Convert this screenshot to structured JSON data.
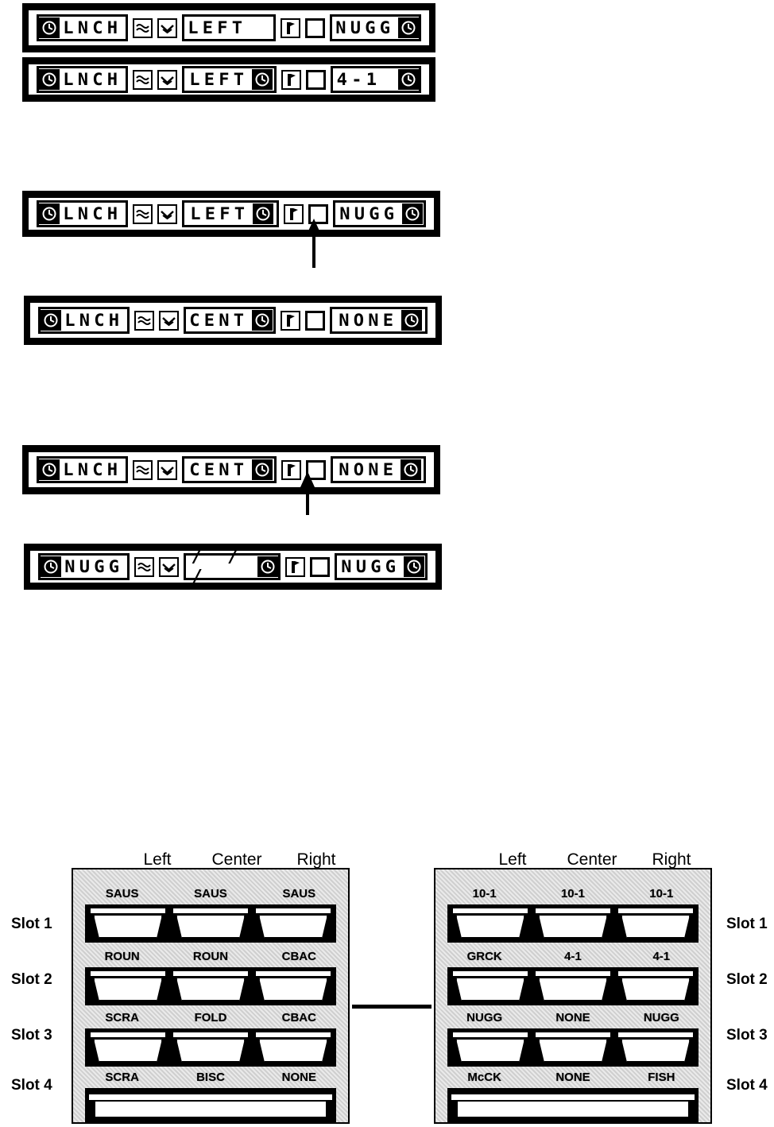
{
  "display_bars": [
    {
      "id": "bar-1",
      "left_field": {
        "icon": "clock-icon",
        "text": "LNCH"
      },
      "icons": [
        "wave-icon",
        "wave-down-icon"
      ],
      "position_field": {
        "text": "LEFT",
        "icon": null
      },
      "flag_icon": "f-flag-icon",
      "checkbox": "empty-box",
      "product_field": {
        "text": "NUGG",
        "icon": "clock-icon"
      },
      "pointer": null
    },
    {
      "id": "bar-2",
      "left_field": {
        "icon": "clock-icon",
        "text": "LNCH"
      },
      "icons": [
        "wave-icon",
        "wave-down-icon"
      ],
      "position_field": {
        "text": "LEFT",
        "icon": "clock-icon"
      },
      "flag_icon": "f-flag-icon",
      "checkbox": "empty-box",
      "product_field": {
        "text": "4-1",
        "icon": "clock-icon"
      },
      "pointer": null
    },
    {
      "id": "bar-3",
      "left_field": {
        "icon": "clock-icon",
        "text": "LNCH"
      },
      "icons": [
        "wave-icon",
        "wave-down-icon"
      ],
      "position_field": {
        "text": "LEFT",
        "icon": "clock-icon"
      },
      "flag_icon": "f-flag-icon",
      "checkbox": "empty-box",
      "product_field": {
        "text": "NUGG",
        "icon": "clock-icon"
      },
      "pointer": "up-arrow-pointer"
    },
    {
      "id": "bar-4",
      "left_field": {
        "icon": "clock-icon",
        "text": "LNCH"
      },
      "icons": [
        "wave-icon",
        "wave-down-icon"
      ],
      "position_field": {
        "text": "CENT",
        "icon": "clock-icon"
      },
      "flag_icon": "f-flag-icon",
      "checkbox": "empty-box",
      "product_field": {
        "text": "NONE",
        "icon": "clock-icon"
      },
      "pointer": null
    },
    {
      "id": "bar-5",
      "left_field": {
        "icon": "clock-icon",
        "text": "LNCH"
      },
      "icons": [
        "wave-icon",
        "wave-down-icon"
      ],
      "position_field": {
        "text": "CENT",
        "icon": "clock-icon"
      },
      "flag_icon": "f-flag-icon",
      "checkbox": "empty-box",
      "product_field": {
        "text": "NONE",
        "icon": "clock-icon"
      },
      "pointer": "up-arrow-pointer"
    },
    {
      "id": "bar-6",
      "left_field": {
        "icon": "clock-icon",
        "text": "NUGG"
      },
      "icons": [
        "wave-icon",
        "wave-down-icon"
      ],
      "position_field": {
        "text": "/ / /",
        "icon": "clock-icon"
      },
      "flag_icon": "f-flag-icon",
      "checkbox": "empty-box",
      "product_field": {
        "text": "NUGG",
        "icon": "clock-icon"
      },
      "pointer": null
    }
  ],
  "bar_text": {
    "b1_left": "LNCH",
    "b1_pos": "LEFT",
    "b1_prod": "NUGG",
    "b2_left": "LNCH",
    "b2_pos": "LEFT",
    "b2_prod": "4-1",
    "b3_left": "LNCH",
    "b3_pos": "LEFT",
    "b3_prod": "NUGG",
    "b4_left": "LNCH",
    "b4_pos": "CENT",
    "b4_prod": "NONE",
    "b5_left": "LNCH",
    "b5_pos": "CENT",
    "b5_prod": "NONE",
    "b6_left": "NUGG",
    "b6_pos": "/ / /",
    "b6_prod": "NUGG"
  },
  "cabinets": {
    "column_headers": [
      "Left",
      "Center",
      "Right"
    ],
    "slot_labels": [
      "Slot 1",
      "Slot 2",
      "Slot 3",
      "Slot 4"
    ],
    "left_cabinet": {
      "name": "breakfast-cabinet",
      "slots": [
        {
          "label": "Slot 1",
          "items": [
            "SAUS",
            "SAUS",
            "SAUS"
          ]
        },
        {
          "label": "Slot 2",
          "items": [
            "ROUN",
            "ROUN",
            "CBAC"
          ]
        },
        {
          "label": "Slot 3",
          "items": [
            "SCRA",
            "FOLD",
            "CBAC"
          ]
        },
        {
          "label": "Slot 4",
          "items": [
            "SCRA",
            "BISC",
            "NONE"
          ]
        }
      ]
    },
    "right_cabinet": {
      "name": "lunch-cabinet",
      "slots": [
        {
          "label": "Slot 1",
          "items": [
            "10-1",
            "10-1",
            "10-1"
          ]
        },
        {
          "label": "Slot 2",
          "items": [
            "GRCK",
            "4-1",
            "4-1"
          ]
        },
        {
          "label": "Slot 3",
          "items": [
            "NUGG",
            "NONE",
            "NUGG"
          ]
        },
        {
          "label": "Slot 4",
          "items": [
            "McCK",
            "NONE",
            "FISH"
          ]
        }
      ]
    }
  },
  "colors": {
    "ink": "#000000",
    "paper": "#ffffff",
    "cabinet_fill": "#dcdcdc"
  }
}
